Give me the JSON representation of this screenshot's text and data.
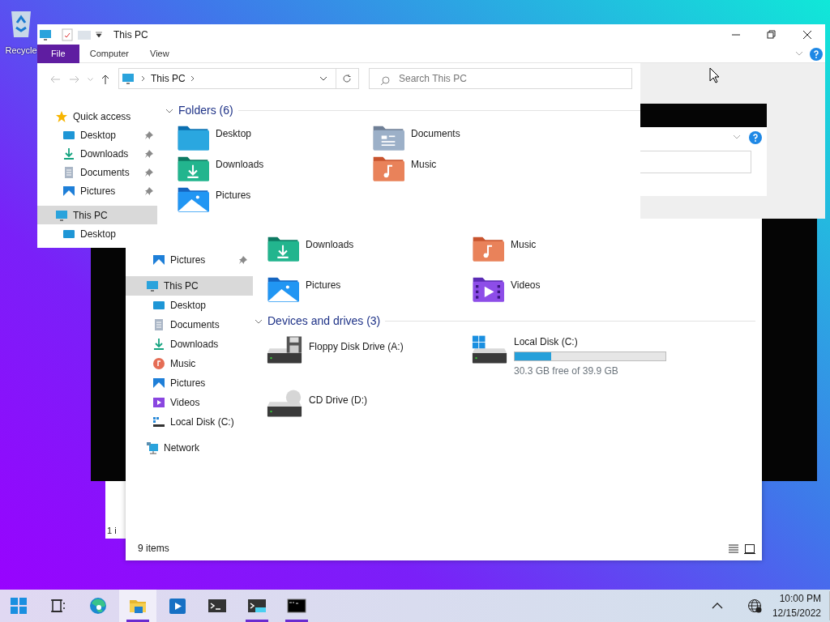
{
  "desktop": {
    "icons": [
      {
        "label": "Recycle"
      }
    ]
  },
  "back_window": {
    "status_text": "1 i"
  },
  "top_window": {
    "title": "This PC",
    "ribbon_tabs": [
      {
        "label": "File",
        "selected": true
      },
      {
        "label": "Computer",
        "selected": false
      },
      {
        "label": "View",
        "selected": false
      }
    ],
    "address": {
      "path": "This PC"
    },
    "search": {
      "placeholder": "Search This PC"
    },
    "nav_pane": [
      {
        "label": "Quick access",
        "kind": "star",
        "selected": false,
        "children": [
          {
            "label": "Desktop",
            "kind": "desktop",
            "pinned": true,
            "selected": false
          },
          {
            "label": "Downloads",
            "kind": "downloads",
            "pinned": true,
            "selected": false
          },
          {
            "label": "Documents",
            "kind": "documents",
            "pinned": true,
            "selected": false
          },
          {
            "label": "Pictures",
            "kind": "pictures",
            "pinned": true,
            "selected": false
          }
        ]
      },
      {
        "label": "This PC",
        "kind": "pc",
        "selected": true,
        "children": [
          {
            "label": "Desktop",
            "kind": "desktop",
            "pinned": false,
            "selected": false
          }
        ]
      }
    ],
    "folders_heading": "Folders (6)",
    "folders": [
      {
        "label": "Desktop",
        "kind": "desktop"
      },
      {
        "label": "Documents",
        "kind": "documents"
      },
      {
        "label": "Downloads",
        "kind": "downloads"
      },
      {
        "label": "Music",
        "kind": "music"
      },
      {
        "label": "Pictures",
        "kind": "pictures"
      }
    ]
  },
  "lower_window": {
    "nav_pane": [
      {
        "label": "Pictures",
        "kind": "pictures",
        "pinned": true,
        "selected": false
      },
      {
        "label": "This PC",
        "kind": "pc",
        "selected": true,
        "children": [
          {
            "label": "Desktop",
            "kind": "desktop",
            "selected": false
          },
          {
            "label": "Documents",
            "kind": "documents",
            "selected": false
          },
          {
            "label": "Downloads",
            "kind": "downloads",
            "selected": false
          },
          {
            "label": "Music",
            "kind": "music",
            "selected": false
          },
          {
            "label": "Pictures",
            "kind": "pictures",
            "selected": false
          },
          {
            "label": "Videos",
            "kind": "videos",
            "selected": false
          },
          {
            "label": "Local Disk (C:)",
            "kind": "drive",
            "selected": false
          }
        ]
      },
      {
        "label": "Network",
        "kind": "network",
        "selected": false
      }
    ],
    "folders": [
      {
        "label": "Downloads",
        "kind": "downloads"
      },
      {
        "label": "Music",
        "kind": "music"
      },
      {
        "label": "Pictures",
        "kind": "pictures"
      },
      {
        "label": "Videos",
        "kind": "videos"
      }
    ],
    "drives_heading": "Devices and drives (3)",
    "drives": [
      {
        "label": "Floppy Disk Drive (A:)",
        "kind": "floppy"
      },
      {
        "label": "Local Disk (C:)",
        "kind": "system",
        "level": 0.24,
        "free_text": "30.3 GB free of 39.9 GB"
      },
      {
        "label": "CD Drive (D:)",
        "kind": "cd"
      }
    ],
    "status_bar": {
      "items": "9 items"
    }
  },
  "taskbar": {
    "apps": [
      {
        "kind": "start",
        "selected": false,
        "running": false
      },
      {
        "kind": "taskview",
        "selected": false,
        "running": false
      },
      {
        "kind": "edge",
        "selected": false,
        "running": false
      },
      {
        "kind": "explorer",
        "selected": true,
        "running": true
      },
      {
        "kind": "media",
        "selected": false,
        "running": false
      },
      {
        "kind": "terminal",
        "selected": false,
        "running": false
      },
      {
        "kind": "terminal2",
        "selected": false,
        "running": true
      },
      {
        "kind": "cmd",
        "selected": false,
        "running": true
      }
    ],
    "time": "10:00 PM",
    "date": "12/15/2022"
  }
}
